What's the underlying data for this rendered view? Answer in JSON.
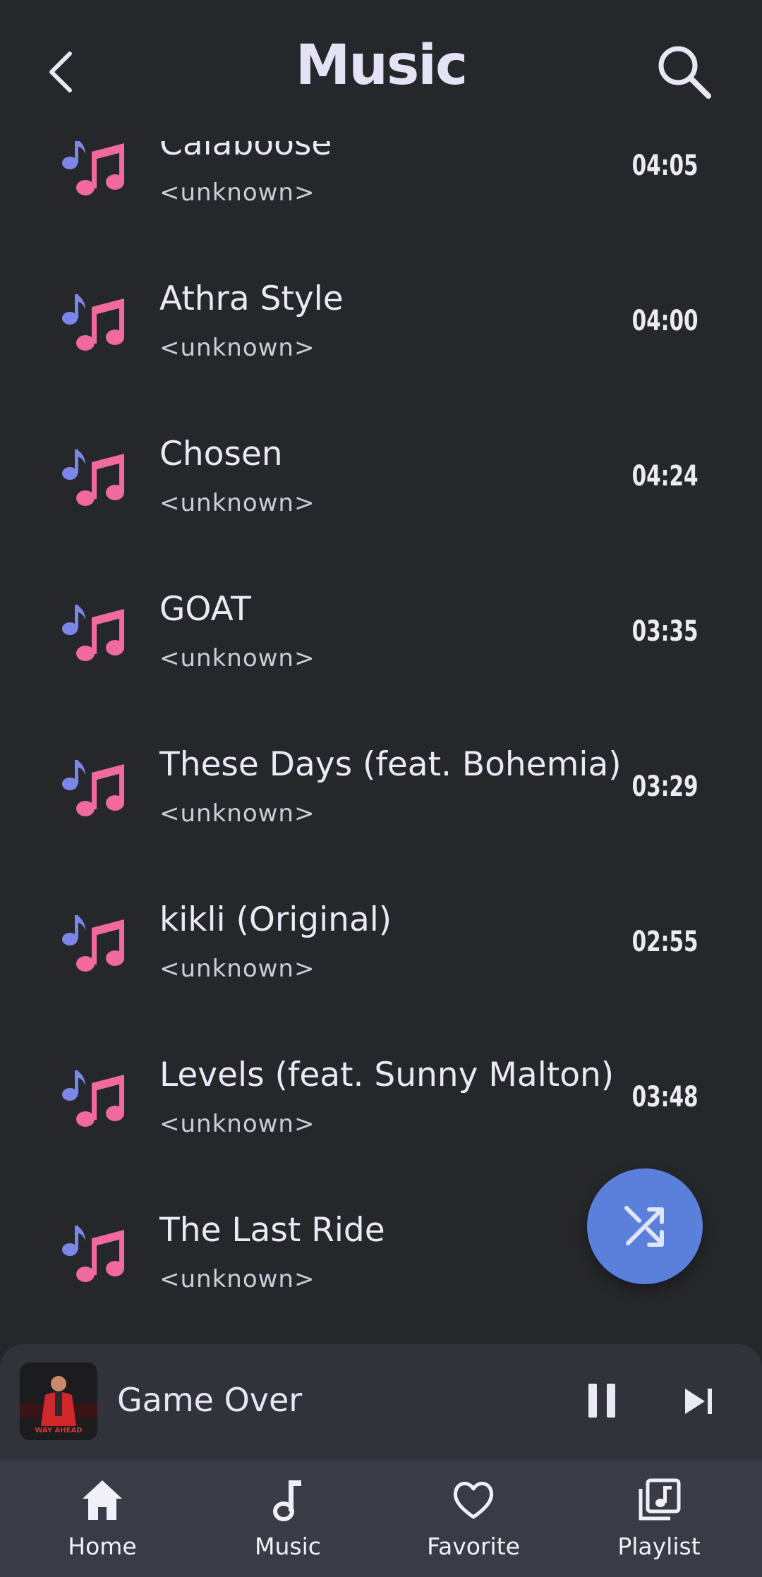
{
  "header": {
    "title": "Music",
    "back_icon": "chevron-left-icon",
    "search_icon": "search-icon"
  },
  "songs": [
    {
      "title": "Calaboose",
      "artist": "<unknown>",
      "duration": "04:05"
    },
    {
      "title": "Athra Style",
      "artist": "<unknown>",
      "duration": "04:00"
    },
    {
      "title": "Chosen",
      "artist": "<unknown>",
      "duration": "04:24"
    },
    {
      "title": "GOAT",
      "artist": "<unknown>",
      "duration": "03:35"
    },
    {
      "title": "These Days (feat. Bohemia)",
      "artist": "<unknown>",
      "duration": "03:29"
    },
    {
      "title": "kikli (Original)",
      "artist": "<unknown>",
      "duration": "02:55"
    },
    {
      "title": "Levels (feat. Sunny Malton)",
      "artist": "<unknown>",
      "duration": "03:48"
    },
    {
      "title": "The Last Ride",
      "artist": "<unknown>",
      "duration": ""
    }
  ],
  "fab": {
    "icon": "shuffle-icon"
  },
  "mini_player": {
    "title": "Game Over",
    "album_text": "WAY AHEAD"
  },
  "nav": [
    {
      "label": "Home",
      "icon": "home-icon"
    },
    {
      "label": "Music",
      "icon": "music-note-icon"
    },
    {
      "label": "Favorite",
      "icon": "heart-icon"
    },
    {
      "label": "Playlist",
      "icon": "playlist-icon"
    }
  ],
  "colors": {
    "background": "#26272b",
    "accent": "#5b80db",
    "note_blue": "#7b86e8",
    "note_pink": "#f06a9e"
  }
}
